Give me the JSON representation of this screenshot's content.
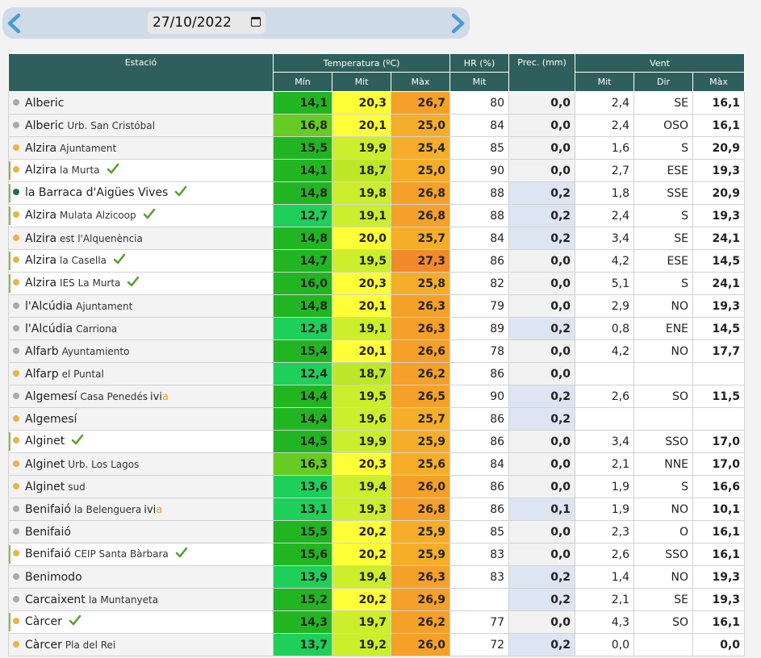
{
  "date": {
    "value": "27/10/2022"
  },
  "headers": {
    "station": "Estació",
    "temperature": "Temperatura (ºC)",
    "hr": "HR (%)",
    "prec": "Prec. (mm)",
    "wind": "Vent",
    "min": "Mín",
    "mit": "Mit",
    "max": "Màx",
    "hr_mit": "Mit",
    "wind_mit": "Mit",
    "wind_dir": "Dir",
    "wind_max": "Màx"
  },
  "colors": {
    "header_bg": "#2f5f5d",
    "dot_gray": "#aaaaaa",
    "dot_yellow": "#e9b34a",
    "dot_teal": "#1f6b66",
    "check": "#5aa02c",
    "prec_blue": "#dde5f2"
  },
  "rows": [
    {
      "name": "Alberic",
      "sub": "",
      "dot": "gray",
      "check": false,
      "hl": false,
      "ivia": false,
      "min": "14,1",
      "mit": "20,3",
      "max": "26,7",
      "hr": "80",
      "prec": "0,0",
      "wmit": "2,4",
      "wdir": "SE",
      "wmax": "16,1",
      "minc": "#22b522",
      "mitc": "#ffff38",
      "maxc": "#f5a029",
      "precc": "#f2f2f2"
    },
    {
      "name": "Alberic",
      "sub": "Urb. San Cristóbal",
      "dot": "gray",
      "check": false,
      "hl": false,
      "ivia": false,
      "min": "16,8",
      "mit": "20,1",
      "max": "25,0",
      "hr": "84",
      "prec": "0,0",
      "wmit": "2,4",
      "wdir": "OSO",
      "wmax": "16,1",
      "minc": "#66cc22",
      "mitc": "#ffff38",
      "maxc": "#f6ae2a",
      "precc": "#f2f2f2"
    },
    {
      "name": "Alzira",
      "sub": "Ajuntament",
      "dot": "yellow",
      "check": false,
      "hl": false,
      "ivia": false,
      "min": "15,5",
      "mit": "19,9",
      "max": "25,4",
      "hr": "85",
      "prec": "0,0",
      "wmit": "1,6",
      "wdir": "S",
      "wmax": "20,9",
      "minc": "#22b522",
      "mitc": "#cdee2c",
      "maxc": "#f6ae2a",
      "precc": "#f2f2f2"
    },
    {
      "name": "Alzira",
      "sub": "la Murta",
      "dot": "yellow",
      "check": true,
      "hl": true,
      "ivia": false,
      "min": "14,1",
      "mit": "18,7",
      "max": "25,0",
      "hr": "90",
      "prec": "0,0",
      "wmit": "2,7",
      "wdir": "ESE",
      "wmax": "19,3",
      "minc": "#22b522",
      "mitc": "#bde82a",
      "maxc": "#f6ae2a",
      "precc": "#f2f2f2"
    },
    {
      "name": "la Barraca d'Aigües Vives",
      "sub": "",
      "dot": "teal",
      "check": true,
      "hl": true,
      "ivia": false,
      "min": "14,8",
      "mit": "19,8",
      "max": "26,8",
      "hr": "88",
      "prec": "0,2",
      "wmit": "1,8",
      "wdir": "SSE",
      "wmax": "20,9",
      "minc": "#22b522",
      "mitc": "#cdee2c",
      "maxc": "#f5a029",
      "precc": "#dde5f2"
    },
    {
      "name": "Alzira",
      "sub": "Mulata Alzicoop",
      "dot": "yellow",
      "check": true,
      "hl": true,
      "ivia": false,
      "min": "12,7",
      "mit": "19,1",
      "max": "26,8",
      "hr": "88",
      "prec": "0,2",
      "wmit": "2,4",
      "wdir": "S",
      "wmax": "19,3",
      "minc": "#1ecf5a",
      "mitc": "#cdee2c",
      "maxc": "#f5a029",
      "precc": "#dde5f2"
    },
    {
      "name": "Alzira",
      "sub": "est l'Alquenència",
      "dot": "yellow",
      "check": false,
      "hl": false,
      "ivia": false,
      "min": "14,8",
      "mit": "20,0",
      "max": "25,7",
      "hr": "84",
      "prec": "0,2",
      "wmit": "3,4",
      "wdir": "SE",
      "wmax": "24,1",
      "minc": "#22b522",
      "mitc": "#ffff38",
      "maxc": "#f6ae2a",
      "precc": "#dde5f2"
    },
    {
      "name": "Alzira",
      "sub": "la Casella",
      "dot": "yellow",
      "check": true,
      "hl": true,
      "ivia": false,
      "min": "14,7",
      "mit": "19,5",
      "max": "27,3",
      "hr": "86",
      "prec": "0,0",
      "wmit": "4,2",
      "wdir": "ESE",
      "wmax": "14,5",
      "minc": "#22b522",
      "mitc": "#cdee2c",
      "maxc": "#f28a2c",
      "precc": "#f2f2f2"
    },
    {
      "name": "Alzira",
      "sub": "IES La Murta",
      "dot": "yellow",
      "check": true,
      "hl": true,
      "ivia": false,
      "min": "16,0",
      "mit": "20,3",
      "max": "25,8",
      "hr": "82",
      "prec": "0,0",
      "wmit": "5,1",
      "wdir": "S",
      "wmax": "24,1",
      "minc": "#22b522",
      "mitc": "#ffff38",
      "maxc": "#f6ae2a",
      "precc": "#f2f2f2"
    },
    {
      "name": "l'Alcúdia",
      "sub": "Ajuntament",
      "dot": "gray",
      "check": false,
      "hl": false,
      "ivia": false,
      "min": "14,8",
      "mit": "20,1",
      "max": "26,3",
      "hr": "79",
      "prec": "0,0",
      "wmit": "2,9",
      "wdir": "NO",
      "wmax": "19,3",
      "minc": "#22b522",
      "mitc": "#ffff38",
      "maxc": "#f5a029",
      "precc": "#f2f2f2"
    },
    {
      "name": "l'Alcúdia",
      "sub": "Carriona",
      "dot": "gray",
      "check": false,
      "hl": false,
      "ivia": false,
      "min": "12,8",
      "mit": "19,1",
      "max": "26,3",
      "hr": "89",
      "prec": "0,2",
      "wmit": "0,8",
      "wdir": "ENE",
      "wmax": "14,5",
      "minc": "#1ecf5a",
      "mitc": "#cdee2c",
      "maxc": "#f5a029",
      "precc": "#dde5f2"
    },
    {
      "name": "Alfarb",
      "sub": "Ayuntamiento",
      "dot": "gray",
      "check": false,
      "hl": false,
      "ivia": false,
      "min": "15,4",
      "mit": "20,1",
      "max": "26,6",
      "hr": "78",
      "prec": "0,0",
      "wmit": "4,2",
      "wdir": "NO",
      "wmax": "17,7",
      "minc": "#22b522",
      "mitc": "#ffff38",
      "maxc": "#f5a029",
      "precc": "#f2f2f2"
    },
    {
      "name": "Alfarp",
      "sub": "el Puntal",
      "dot": "yellow",
      "check": false,
      "hl": false,
      "ivia": false,
      "min": "12,4",
      "mit": "18,7",
      "max": "26,2",
      "hr": "86",
      "prec": "0,0",
      "wmit": "",
      "wdir": "",
      "wmax": "",
      "minc": "#1ecf5a",
      "mitc": "#bde82a",
      "maxc": "#f5a029",
      "precc": "#f2f2f2"
    },
    {
      "name": "Algemesí",
      "sub": "Casa Penedés",
      "dot": "gray",
      "check": false,
      "hl": false,
      "ivia": true,
      "min": "14,4",
      "mit": "19,5",
      "max": "26,5",
      "hr": "90",
      "prec": "0,2",
      "wmit": "2,6",
      "wdir": "SO",
      "wmax": "11,5",
      "minc": "#22b522",
      "mitc": "#cdee2c",
      "maxc": "#f5a029",
      "precc": "#dde5f2"
    },
    {
      "name": "Algemesí",
      "sub": "",
      "dot": "yellow",
      "check": false,
      "hl": false,
      "ivia": false,
      "min": "14,4",
      "mit": "19,6",
      "max": "25,7",
      "hr": "86",
      "prec": "0,2",
      "wmit": "",
      "wdir": "",
      "wmax": "",
      "minc": "#22b522",
      "mitc": "#cdee2c",
      "maxc": "#f6ae2a",
      "precc": "#dde5f2"
    },
    {
      "name": "Alginet",
      "sub": "",
      "dot": "yellow",
      "check": true,
      "hl": true,
      "ivia": false,
      "min": "14,5",
      "mit": "19,9",
      "max": "25,9",
      "hr": "86",
      "prec": "0,0",
      "wmit": "3,4",
      "wdir": "SSO",
      "wmax": "17,0",
      "minc": "#22b522",
      "mitc": "#cdee2c",
      "maxc": "#f6ae2a",
      "precc": "#f2f2f2"
    },
    {
      "name": "Alginet",
      "sub": "Urb. Los Lagos",
      "dot": "yellow",
      "check": false,
      "hl": false,
      "ivia": false,
      "min": "16,3",
      "mit": "20,3",
      "max": "25,6",
      "hr": "84",
      "prec": "0,0",
      "wmit": "2,1",
      "wdir": "NNE",
      "wmax": "17,0",
      "minc": "#66cc22",
      "mitc": "#ffff38",
      "maxc": "#f6ae2a",
      "precc": "#f2f2f2"
    },
    {
      "name": "Alginet",
      "sub": "sud",
      "dot": "yellow",
      "check": false,
      "hl": false,
      "ivia": false,
      "min": "13,6",
      "mit": "19,4",
      "max": "26,0",
      "hr": "86",
      "prec": "0,0",
      "wmit": "1,9",
      "wdir": "S",
      "wmax": "16,6",
      "minc": "#1ecf5a",
      "mitc": "#cdee2c",
      "maxc": "#f5a029",
      "precc": "#f2f2f2"
    },
    {
      "name": "Benifaió",
      "sub": "la Belenguera",
      "dot": "gray",
      "check": false,
      "hl": false,
      "ivia": true,
      "min": "13,1",
      "mit": "19,3",
      "max": "26,8",
      "hr": "86",
      "prec": "0,1",
      "wmit": "1,9",
      "wdir": "NO",
      "wmax": "10,1",
      "minc": "#1ecf5a",
      "mitc": "#cdee2c",
      "maxc": "#f5a029",
      "precc": "#dde5f2"
    },
    {
      "name": "Benifaió",
      "sub": "",
      "dot": "gray",
      "check": false,
      "hl": false,
      "ivia": false,
      "min": "15,5",
      "mit": "20,2",
      "max": "25,9",
      "hr": "85",
      "prec": "0,0",
      "wmit": "2,3",
      "wdir": "O",
      "wmax": "16,1",
      "minc": "#22b522",
      "mitc": "#ffff38",
      "maxc": "#f6ae2a",
      "precc": "#f2f2f2"
    },
    {
      "name": "Benifaió",
      "sub": "CEIP Santa Bàrbara",
      "dot": "yellow",
      "check": true,
      "hl": true,
      "ivia": false,
      "min": "15,6",
      "mit": "20,2",
      "max": "25,9",
      "hr": "83",
      "prec": "0,0",
      "wmit": "2,6",
      "wdir": "SSO",
      "wmax": "16,1",
      "minc": "#22b522",
      "mitc": "#ffff38",
      "maxc": "#f6ae2a",
      "precc": "#f2f2f2"
    },
    {
      "name": "Benimodo",
      "sub": "",
      "dot": "gray",
      "check": false,
      "hl": false,
      "ivia": false,
      "min": "13,9",
      "mit": "19,4",
      "max": "26,3",
      "hr": "83",
      "prec": "0,2",
      "wmit": "1,4",
      "wdir": "NO",
      "wmax": "19,3",
      "minc": "#1ecf5a",
      "mitc": "#cdee2c",
      "maxc": "#f5a029",
      "precc": "#dde5f2"
    },
    {
      "name": "Carcaixent",
      "sub": "la Muntanyeta",
      "dot": "gray",
      "check": false,
      "hl": false,
      "ivia": false,
      "min": "15,2",
      "mit": "20,2",
      "max": "26,9",
      "hr": "",
      "prec": "0,2",
      "wmit": "2,1",
      "wdir": "SE",
      "wmax": "19,3",
      "minc": "#22b522",
      "mitc": "#ffff38",
      "maxc": "#f5a029",
      "precc": "#dde5f2"
    },
    {
      "name": "Càrcer",
      "sub": "",
      "dot": "yellow",
      "check": true,
      "hl": true,
      "ivia": false,
      "min": "14,3",
      "mit": "19,7",
      "max": "26,2",
      "hr": "77",
      "prec": "0,0",
      "wmit": "4,3",
      "wdir": "SO",
      "wmax": "16,1",
      "minc": "#22b522",
      "mitc": "#cdee2c",
      "maxc": "#f5a029",
      "precc": "#f2f2f2"
    },
    {
      "name": "Càrcer",
      "sub": "Pla del Rei",
      "dot": "yellow",
      "check": false,
      "hl": false,
      "ivia": false,
      "min": "13,7",
      "mit": "19,2",
      "max": "26,0",
      "hr": "72",
      "prec": "0,2",
      "wmit": "0,0",
      "wdir": "",
      "wmax": "0,0",
      "minc": "#1ecf5a",
      "mitc": "#cdee2c",
      "maxc": "#f5a029",
      "precc": "#dde5f2"
    }
  ],
  "ivia_label": {
    "a": "ivi",
    "b": "a"
  }
}
